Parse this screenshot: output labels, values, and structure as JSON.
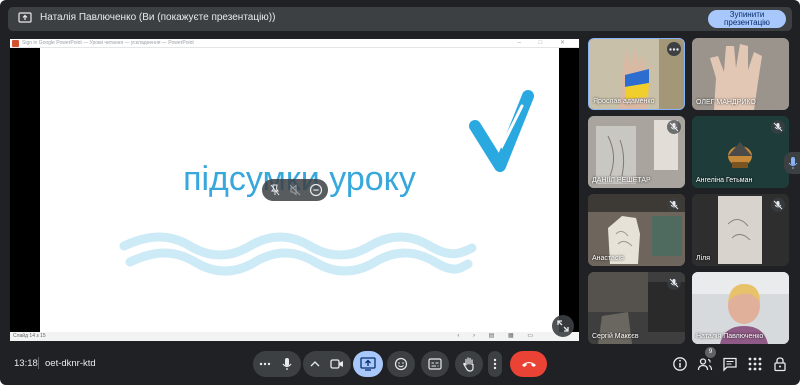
{
  "banner": {
    "text": "Наталія Павлюченко (Ви (покажуєте презентацію))",
    "stop_line1": "Зупинити",
    "stop_line2": "презентацію"
  },
  "slide": {
    "window_title": "Sign in Google PowerPoint — Уроки читання — ускладнення — PowerPoint",
    "title": "підсумки уроку",
    "slide_number": "Слайд 14 з 15",
    "accent_color": "#38a7dc"
  },
  "participants": [
    {
      "name": "Ярослав адаменко",
      "muted": false,
      "more_options": true
    },
    {
      "name": "ОЛЕГ МАНДРИКО",
      "muted": false
    },
    {
      "name": "ДАНІІЛ РЕШЕТАР",
      "muted": true
    },
    {
      "name": "Ангеліна Гетьман",
      "muted": true
    },
    {
      "name": "Анастасія",
      "muted": true
    },
    {
      "name": "Ліля",
      "muted": true
    },
    {
      "name": "Сергій Макєєв",
      "muted": true
    },
    {
      "name": "Наталія Павлюченко",
      "muted": false
    }
  ],
  "bottom": {
    "time": "13:18",
    "meeting_code": "oet-dknr-ktd",
    "people_count": "9"
  },
  "icons": [
    "present-icon",
    "mic-icon",
    "chevron-up-icon",
    "camera-icon",
    "emoji-icon",
    "captions-icon",
    "hand-icon",
    "more-icon",
    "end-call-icon",
    "info-icon",
    "people-icon",
    "chat-icon",
    "apps-icon",
    "lock-icon"
  ],
  "colors": {
    "background": "#202124",
    "control": "#3c4043",
    "end_call": "#ea4335",
    "present_active": "#a8c7fa"
  }
}
